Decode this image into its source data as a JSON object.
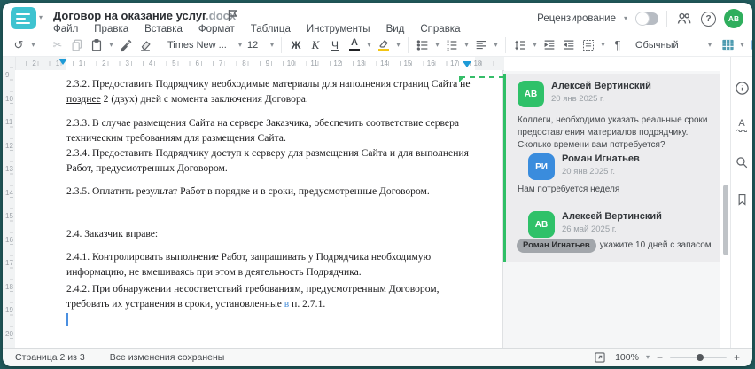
{
  "window": {
    "title": "Договор на оказание услуг",
    "ext": ".docx"
  },
  "menu": {
    "items": [
      "Файл",
      "Правка",
      "Вставка",
      "Формат",
      "Таблица",
      "Инструменты",
      "Вид",
      "Справка"
    ]
  },
  "topbar": {
    "review": "Рецензирование",
    "avatar": "АВ"
  },
  "icons": {
    "caret": "▾",
    "undo": "↺",
    "cut": "✂",
    "para": "¶",
    "more": "⋯",
    "help": "?",
    "minus": "−",
    "plus": "+",
    "spell_letter": "А"
  },
  "toolbar": {
    "font_name": "Times New ...",
    "font_size": "12",
    "bold": "Ж",
    "italic": "К",
    "underline": "Ч",
    "font_color_letter": "А",
    "style": "Обычный"
  },
  "ruler": {
    "left": [
      "1",
      "2"
    ],
    "main": [
      "1",
      "2",
      "3",
      "4",
      "5",
      "6",
      "7",
      "8",
      "9",
      "10",
      "11",
      "12",
      "13",
      "14",
      "15",
      "16",
      "17",
      "18"
    ],
    "vertical": [
      "9",
      "10",
      "11",
      "12",
      "13",
      "14",
      "15",
      "16",
      "17",
      "18",
      "19",
      "20"
    ]
  },
  "document": {
    "p232_a": "2.3.2. Предоставить Подрядчику необходимые материалы для наполнения страниц Сайта не ",
    "p232_b": "позднее",
    "p232_c": " 2 (двух) дней с момента заключения Договора.",
    "p233": "2.3.3. В случае размещения Сайта на сервере Заказчика, обеспечить соответствие сервера техническим требованиям для размещения Сайта.",
    "p234": "2.3.4. Предоставить Подрядчику доступ к серверу для размещения Сайта и для выполнения Работ, предусмотренных Договором.",
    "p235": "2.3.5. Оплатить результат Работ в порядке и в сроки, предусмотренные Договором.",
    "p24": "2.4. Заказчик вправе:",
    "p241": "2.4.1. Контролировать выполнение Работ, запрашивать у Подрядчика необходимую информацию, не вмешиваясь при этом в деятельность Подрядчика.",
    "p242_a": "2.4.2. При обнаружении несоответствий требованиям, предусмотренным Договором, требовать их устранения в сроки, установленные ",
    "p242_b": "в",
    "p242_c": " п. 2.7.1."
  },
  "comments": {
    "thread": [
      {
        "initials": "АВ",
        "name": "Алексей Вертинский",
        "date": "20 янв 2025 г.",
        "text": "Коллеги, необходимо указать реальные сроки предоставления материалов подрядчику. Сколько времени вам потребуется?",
        "color": "#2fc169"
      },
      {
        "initials": "РИ",
        "name": "Роман Игнатьев",
        "date": "20 янв 2025 г.",
        "text": "Нам потребуется неделя",
        "color": "#3a8cdd"
      },
      {
        "initials": "АВ",
        "name": "Алексей Вертинский",
        "date": "26 май 2025 г.",
        "mention": "Роман Игнатьев",
        "text": "укажите 10 дней с запасом",
        "color": "#2fc169"
      }
    ]
  },
  "statusbar": {
    "page": "Страница 2 из 3",
    "saved": "Все изменения сохранены",
    "zoom": "100%"
  },
  "colors": {
    "app_teal": "#3ec3d0",
    "comment_green": "#2fc169",
    "comment_blue": "#3a8cdd",
    "marker_blue": "#1e9bd7"
  }
}
